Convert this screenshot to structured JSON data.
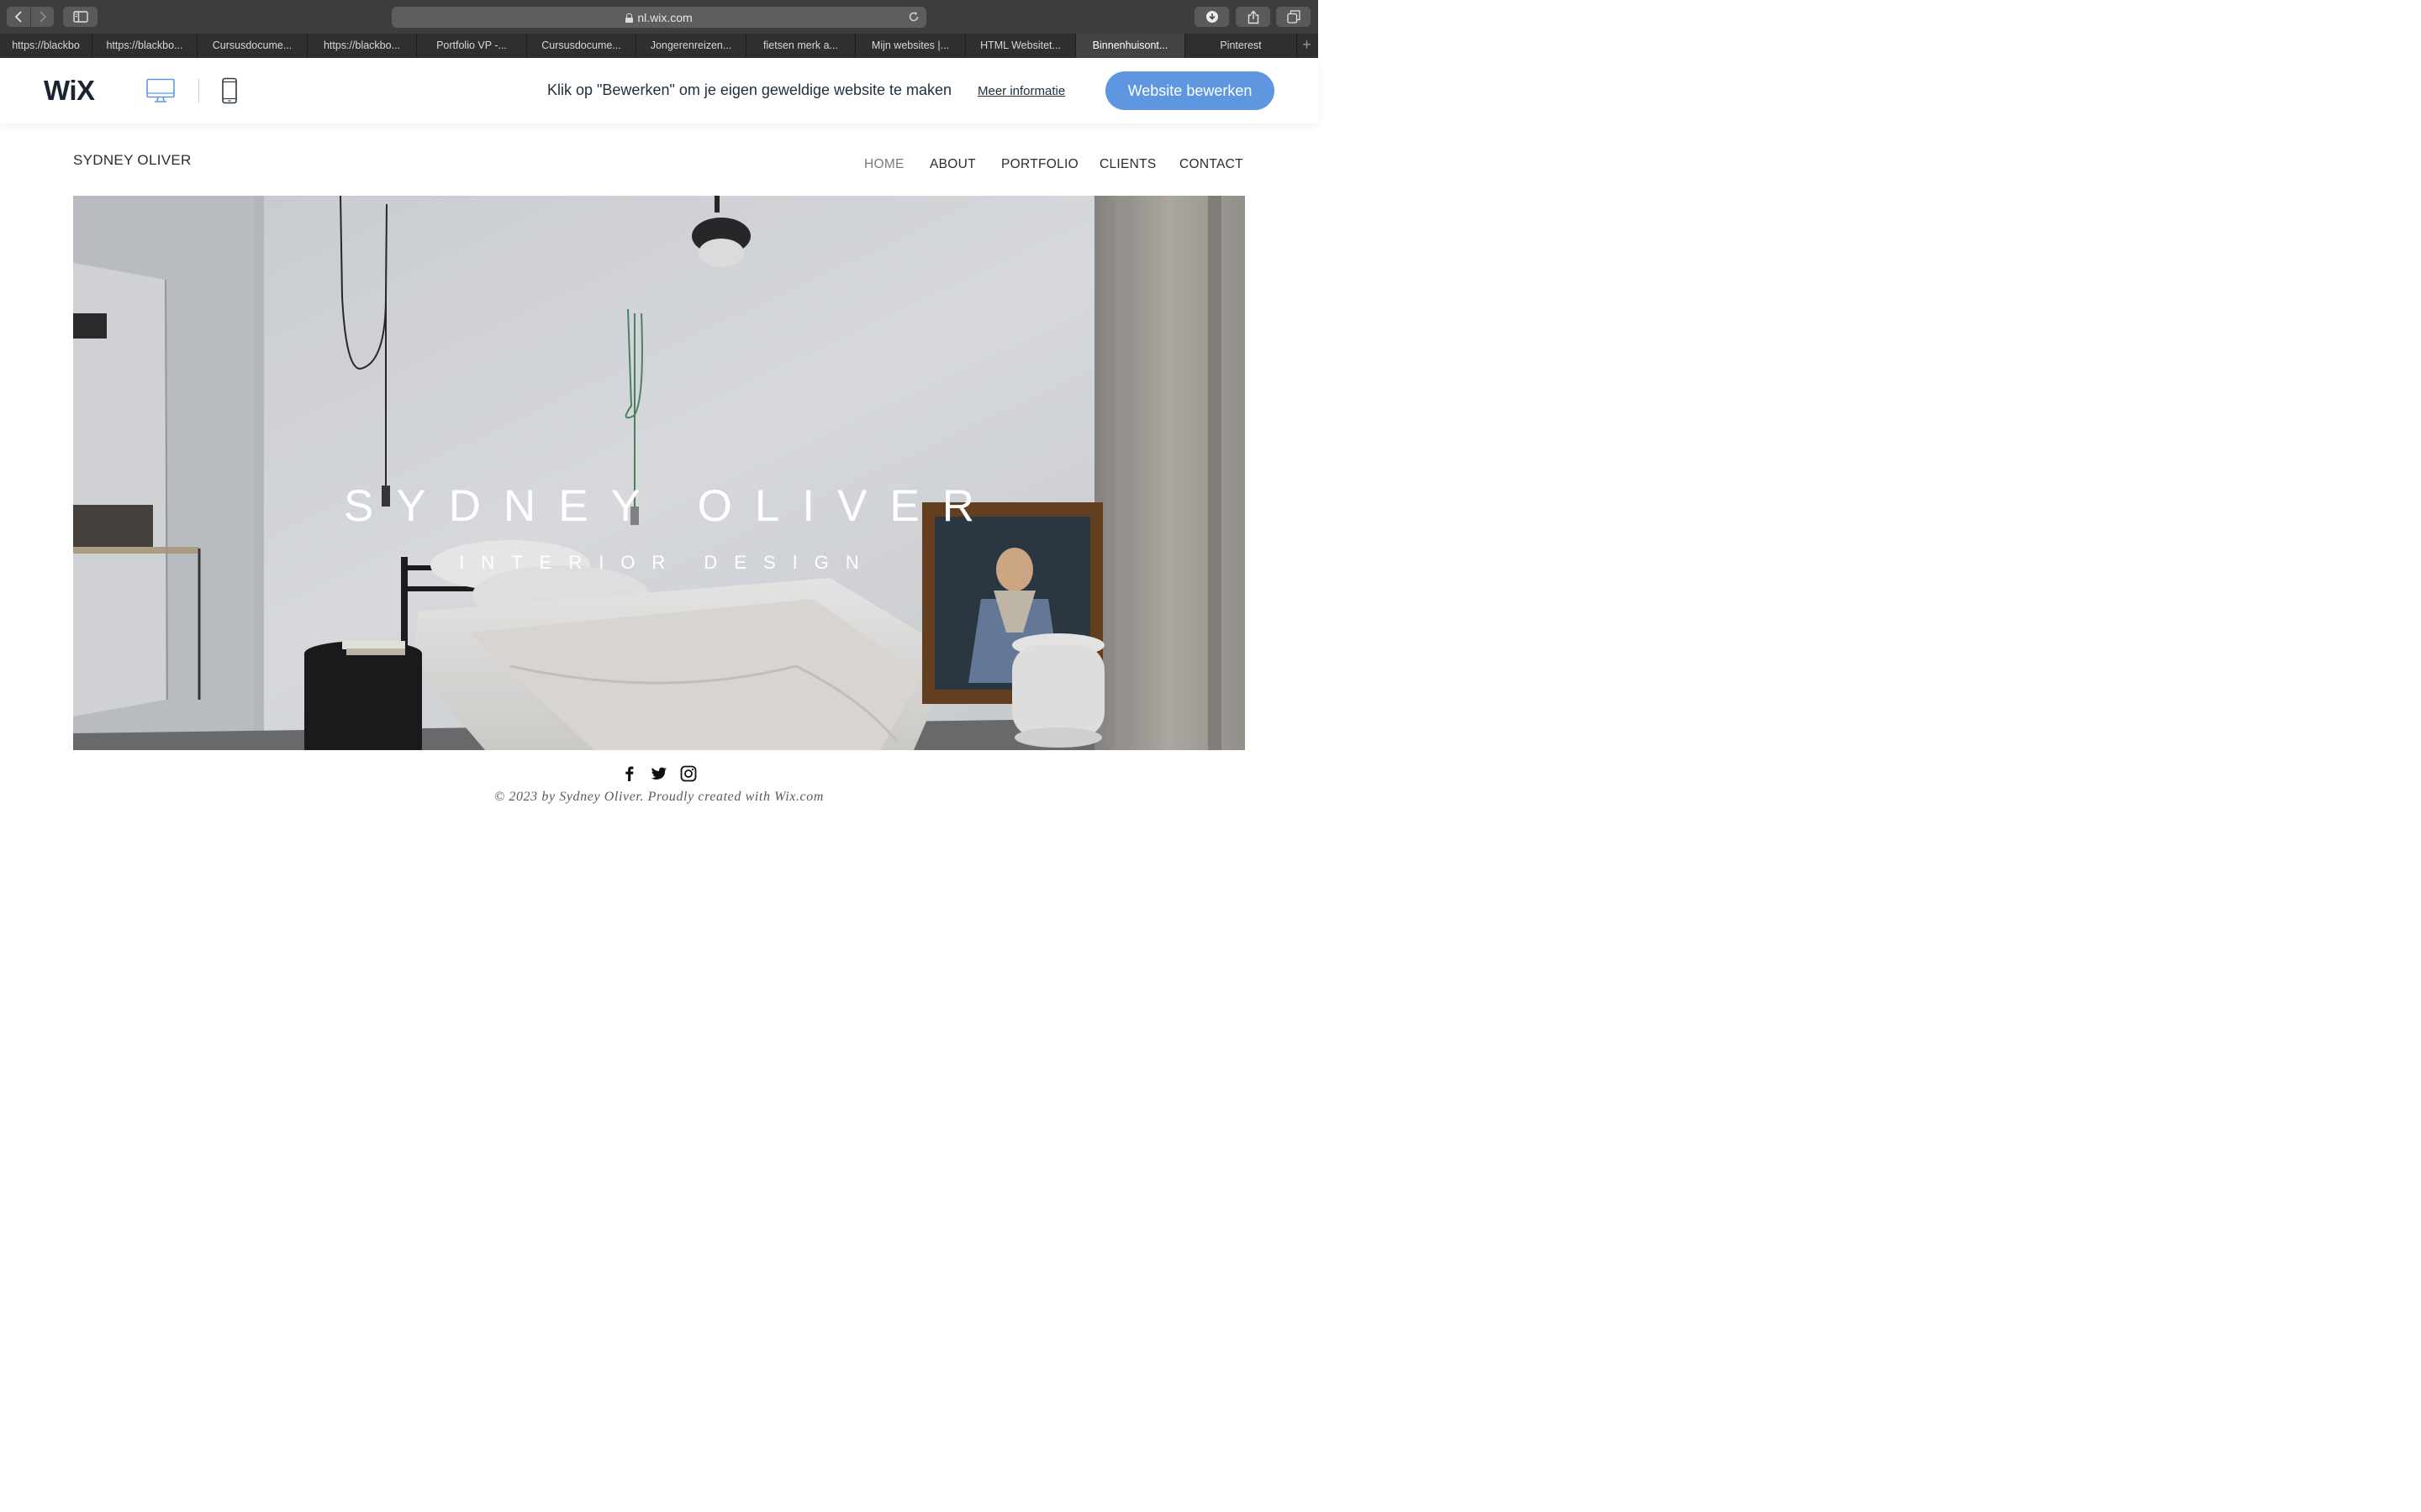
{
  "browser": {
    "address": "nl.wix.com",
    "tabs": [
      {
        "label": "https://blackbo"
      },
      {
        "label": "https://blackbo..."
      },
      {
        "label": "Cursusdocume..."
      },
      {
        "label": "https://blackbo..."
      },
      {
        "label": "Portfolio VP -..."
      },
      {
        "label": "Cursusdocume..."
      },
      {
        "label": "Jongerenreizen..."
      },
      {
        "label": "fietsen merk a..."
      },
      {
        "label": "Mijn websites |..."
      },
      {
        "label": "HTML Websitet..."
      },
      {
        "label": "Binnenhuisont...",
        "active": true
      },
      {
        "label": "Pinterest"
      }
    ],
    "new_tab": "+"
  },
  "wix_bar": {
    "logo": "WiX",
    "message": "Klik op \"Bewerken\" om je eigen geweldige website te maken",
    "more_link": "Meer informatie",
    "edit_button": "Website bewerken",
    "accent_color": "#5e97e0"
  },
  "site": {
    "name": "SYDNEY OLIVER",
    "nav": [
      "HOME",
      "ABOUT",
      "PORTFOLIO",
      "CLIENTS",
      "CONTACT"
    ],
    "current_nav": "HOME",
    "hero": {
      "title": "SYDNEY OLIVER",
      "subtitle": "INTERIOR DESIGN"
    },
    "social_icons": [
      "facebook-icon",
      "twitter-icon",
      "instagram-icon"
    ],
    "footer": "© 2023 by Sydney Oliver. Proudly created with Wix.com"
  }
}
